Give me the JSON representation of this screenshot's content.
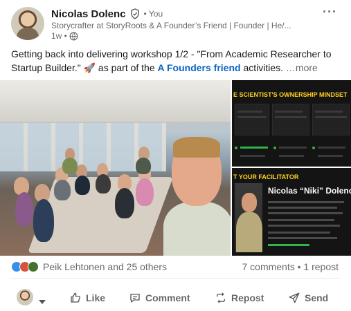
{
  "author": {
    "name": "Nicolas Dolenc",
    "you_label": "• You",
    "headline": "Storycrafter at StoryRoots & A Founder’s Friend | Founder | He/...",
    "time": "1w •"
  },
  "post": {
    "text_before": "Getting back into delivering workshop 1/2 - \"From Academic Researcher to Startup Builder.\" 🚀 as part of the ",
    "link_text": "A Founders friend",
    "text_after": " activities.",
    "see_more": " …more"
  },
  "media": {
    "slide_top_title": "E SCIENTIST'S OWNERSHIP MINDSET",
    "slide_bottom_label": "T YOUR FACILITATOR",
    "facilitator_name": "Nicolas “Niki” Dolenc"
  },
  "social": {
    "reactions_text": "Peik Lehtonen and 25 others",
    "counts": "7 comments • 1 repost"
  },
  "actions": {
    "like": "Like",
    "comment": "Comment",
    "repost": "Repost",
    "send": "Send"
  },
  "colors": {
    "link": "#0a66c2",
    "slide_accent": "#ffd21f",
    "slide_bg": "#141414"
  }
}
